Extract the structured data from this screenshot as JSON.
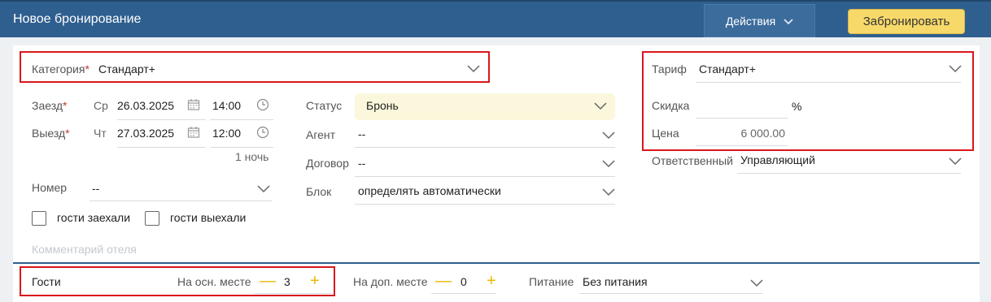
{
  "header": {
    "title": "Новое бронирование",
    "actions_label": "Действия",
    "book_label": "Забронировать"
  },
  "form": {
    "category": {
      "label": "Категория",
      "value": "Стандарт+"
    },
    "checkin": {
      "label": "Заезд",
      "weekday": "Ср",
      "date": "26.03.2025",
      "time": "14:00"
    },
    "checkout": {
      "label": "Выезд",
      "weekday": "Чт",
      "date": "27.03.2025",
      "time": "12:00"
    },
    "nights": "1 ночь",
    "room": {
      "label": "Номер",
      "value": "--"
    },
    "checked_in": "гости заехали",
    "checked_out": "гости выехали",
    "comment_placeholder": "Комментарий отеля",
    "status": {
      "label": "Статус",
      "value": "Бронь"
    },
    "agent": {
      "label": "Агент",
      "value": "--"
    },
    "contract": {
      "label": "Договор",
      "value": "--"
    },
    "block": {
      "label": "Блок",
      "value": "определять автоматически"
    },
    "tariff": {
      "label": "Тариф",
      "value": "Стандарт+"
    },
    "discount": {
      "label": "Скидка",
      "unit": "%"
    },
    "price": {
      "label": "Цена",
      "value": "6 000.00"
    },
    "responsible": {
      "label": "Ответственный",
      "value": "Управляющий"
    }
  },
  "guests": {
    "title": "Гости",
    "main_place_label": "На осн. месте",
    "main_place_count": "3",
    "extra_place_label": "На доп. месте",
    "extra_place_count": "0",
    "meal_label": "Питание",
    "meal_value": "Без питания"
  },
  "colors": {
    "header_bg": "#2f5f8f",
    "book_btn": "#f7d96a",
    "highlight": "#d9171c"
  }
}
